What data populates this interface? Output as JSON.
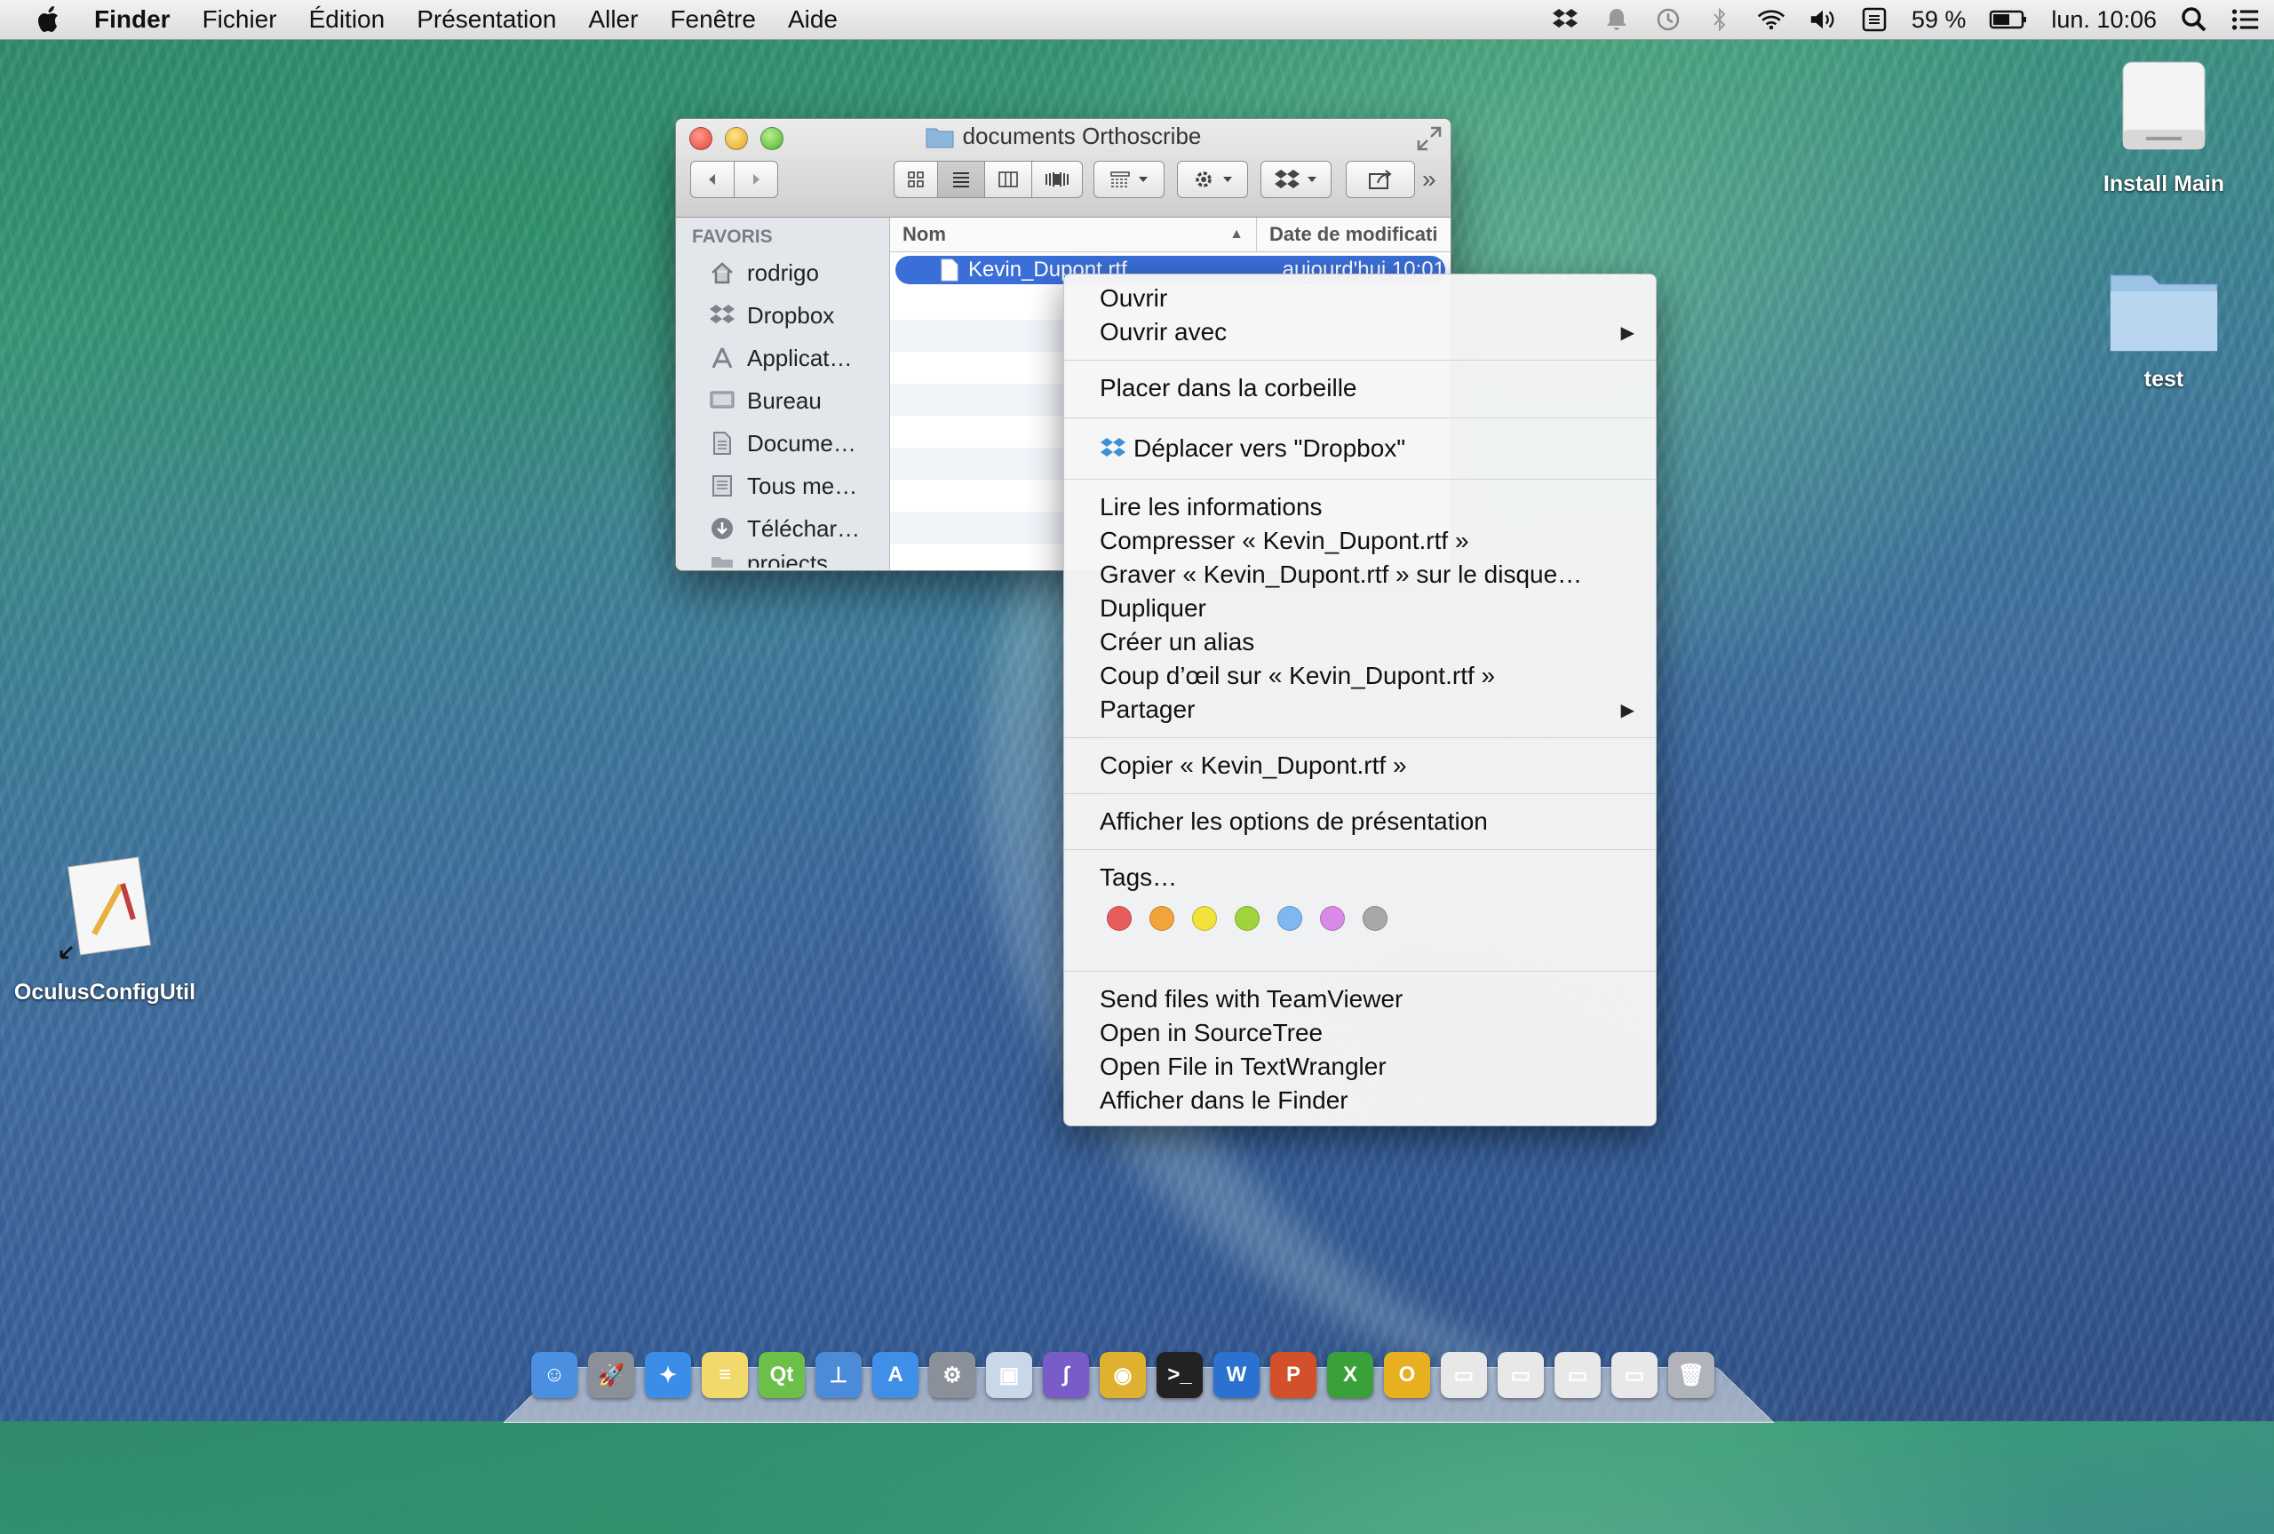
{
  "menubar": {
    "app_name": "Finder",
    "items": [
      "Fichier",
      "Édition",
      "Présentation",
      "Aller",
      "Fenêtre",
      "Aide"
    ],
    "battery": "59 %",
    "clock": "lun. 10:06"
  },
  "desktop": {
    "install_drive_label": "Install Main",
    "test_folder_label": "test",
    "oculus_label": "OculusConfigUtil"
  },
  "finder": {
    "title": "documents Orthoscribe",
    "sidebar_heading": "FAVORIS",
    "sidebar_items": [
      "rodrigo",
      "Dropbox",
      "Applicat…",
      "Bureau",
      "Docume…",
      "Tous me…",
      "Téléchar…",
      "projects"
    ],
    "col_name": "Nom",
    "col_date": "Date de modificati",
    "file_name": "Kevin_Dupont.rtf",
    "file_date": "aujourd'hui 10:01"
  },
  "context_menu": {
    "open": "Ouvrir",
    "open_with": "Ouvrir avec",
    "trash": "Placer dans la corbeille",
    "move_dropbox": "Déplacer vers \"Dropbox\"",
    "get_info": "Lire les informations",
    "compress": "Compresser « Kevin_Dupont.rtf »",
    "burn": "Graver « Kevin_Dupont.rtf » sur le disque…",
    "duplicate": "Dupliquer",
    "alias": "Créer un alias",
    "quicklook": "Coup d’œil sur « Kevin_Dupont.rtf »",
    "share": "Partager",
    "copy": "Copier « Kevin_Dupont.rtf »",
    "view_options": "Afficher les options de présentation",
    "tags": "Tags…",
    "tag_colors": [
      "#e85c5c",
      "#f2a43a",
      "#f2e23a",
      "#9fd43a",
      "#7fb8f0",
      "#d98ae8",
      "#a8a8a8"
    ],
    "teamviewer": "Send files with TeamViewer",
    "sourcetree": "Open in SourceTree",
    "textwrangler": "Open File in TextWrangler",
    "show_in_finder": "Afficher dans le Finder"
  },
  "dock": {
    "apps": [
      "finder-icon",
      "launchpad-icon",
      "safari-icon",
      "notes-icon",
      "qt-icon",
      "keynote-icon",
      "app-store-icon",
      "system-preferences-icon",
      "preview-icon",
      "tower-icon",
      "chrome-icon",
      "terminal-icon",
      "word-icon",
      "powerpoint-icon",
      "excel-icon",
      "outlook-icon",
      "window-thumbnail-icon",
      "window-thumbnail-icon",
      "window-thumbnail-icon",
      "window-thumbnail-icon",
      "trash-icon"
    ]
  }
}
